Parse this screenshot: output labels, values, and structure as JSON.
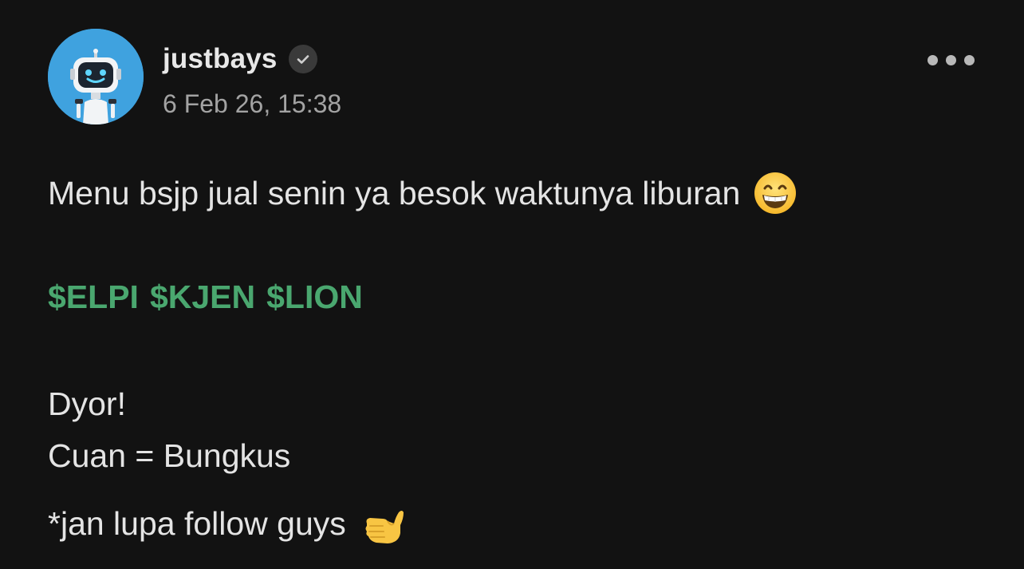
{
  "post": {
    "author": {
      "username": "justbays",
      "verified": true,
      "avatar_icon": "robot-avatar-icon"
    },
    "timestamp": "6 Feb 26, 15:38",
    "content": {
      "line1": "Menu bsjp jual senin ya besok waktunya liburan",
      "line1_emoji": "grinning-face-icon",
      "tickers": [
        "$ELPI",
        "$KJEN",
        "$LION"
      ],
      "line_dyor": "Dyor!",
      "line_cuan": "Cuan = Bungkus",
      "line_follow": "*jan lupa follow guys",
      "line_follow_emoji": "call-me-hand-icon"
    },
    "more_icon": "more-options-icon"
  },
  "colors": {
    "background": "#121212",
    "ticker": "#4aa76f",
    "avatar_bg": "#3fa2df",
    "timestamp": "#a3a3a3"
  }
}
